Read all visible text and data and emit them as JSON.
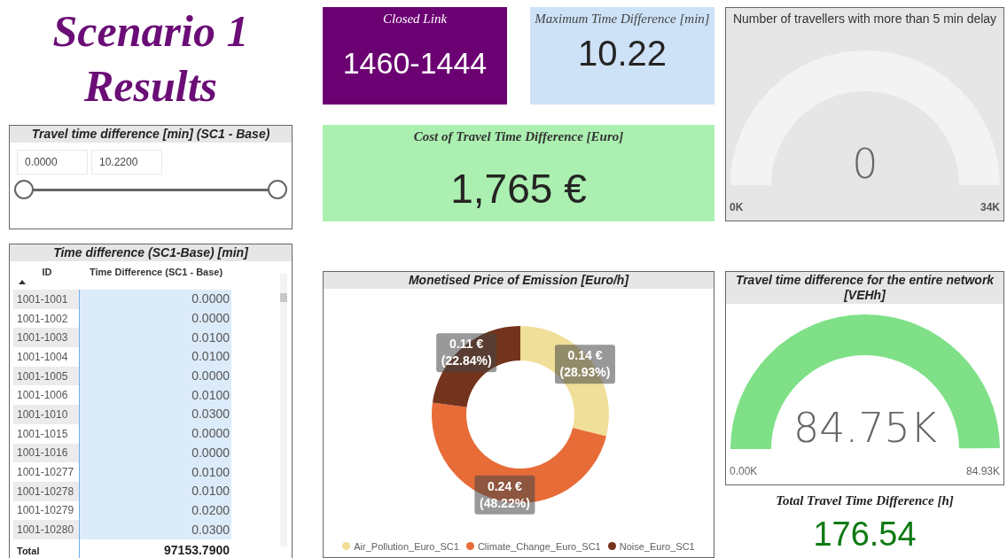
{
  "title": "Scenario 1 Results",
  "slicer": {
    "title": "Travel time difference [min] (SC1 - Base)",
    "min_value": "0.0000",
    "max_value": "10.2200",
    "thumbs": [
      {
        "level": 0
      },
      {
        "level": 1
      }
    ]
  },
  "table": {
    "title": "Time difference (SC1-Base) [min]",
    "columns": [
      {
        "label": "ID",
        "sorted": true
      },
      {
        "label": "Time Difference (SC1 - Base)",
        "sorted": false
      }
    ],
    "rows": [
      {
        "id": "1001-1001",
        "value": "0.0000"
      },
      {
        "id": "1001-1002",
        "value": "0.0000"
      },
      {
        "id": "1001-1003",
        "value": "0.0100"
      },
      {
        "id": "1001-1004",
        "value": "0.0100"
      },
      {
        "id": "1001-1005",
        "value": "0.0000"
      },
      {
        "id": "1001-1006",
        "value": "0.0100"
      },
      {
        "id": "1001-1010",
        "value": "0.0300"
      },
      {
        "id": "1001-1015",
        "value": "0.0000"
      },
      {
        "id": "1001-1016",
        "value": "0.0000"
      },
      {
        "id": "1001-10277",
        "value": "0.0100"
      },
      {
        "id": "1001-10278",
        "value": "0.0100"
      },
      {
        "id": "1001-10279",
        "value": "0.0200"
      },
      {
        "id": "1001-10280",
        "value": "0.0300"
      }
    ],
    "total": {
      "label": "Total",
      "value": "97153.7900"
    }
  },
  "closed_link": {
    "title": "Closed Link",
    "value": "1460-1444"
  },
  "max_time_difference": {
    "title": "Maximum Time Difference [min]",
    "value": "10.22"
  },
  "cost_card": {
    "title": "Cost of Travel Time Difference [Euro]",
    "value": "1,765 €"
  },
  "emission_chart": {
    "title": "Monetised Price of Emission [Euro/h]",
    "chart_data": {
      "type": "donut",
      "categories": [
        "Air_Pollution_Euro_SC1",
        "Climate_Change_Euro_SC1",
        "Noise_Euro_SC1"
      ],
      "values": [
        28.93,
        48.22,
        22.84
      ]
    },
    "slice_labels": [
      {
        "value": "0.14 €",
        "share": "(28.93%)"
      },
      {
        "value": "0.24 €",
        "share": "(48.22%)"
      },
      {
        "value": "0.11 €",
        "share": "(22.84%)"
      }
    ],
    "legend": [
      {
        "color": "#f0df98"
      },
      {
        "color": "#e76c38"
      },
      {
        "color": "#74331c"
      }
    ]
  },
  "delay_gauge": {
    "title": "Number of travellers with more than 5 min delay",
    "value": "0",
    "min_label": "0K",
    "max_label": "34K"
  },
  "network_gauge": {
    "title": "Travel time difference for the entire network [VEHh]",
    "value": "84.75K",
    "min_label": "0.00K",
    "max_label": "84.93K",
    "level": 0.998
  },
  "total_time": {
    "title": "Total Travel Time Difference [h]",
    "value": "176.54"
  }
}
